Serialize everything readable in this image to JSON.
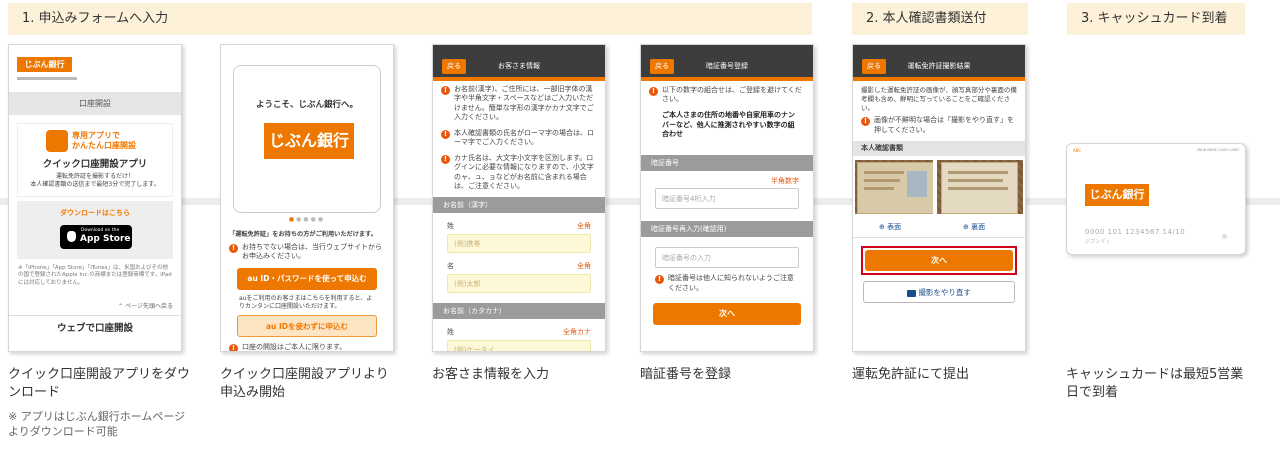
{
  "steps": [
    {
      "label": "1. 申込みフォームへ入力"
    },
    {
      "label": "2. 本人確認書類送付"
    },
    {
      "label": "3. キャッシュカード到着"
    }
  ],
  "brand": {
    "logo": "じぶん銀行",
    "accent": "#ee7700",
    "header_bg": "#fdf2d9",
    "warn": "#e8580c"
  },
  "screen1": {
    "topbar_label": "口座開設",
    "app_line1": "専用アプリで",
    "app_line2": "かんたん口座開設",
    "app_title": "クイック口座開設アプリ",
    "desc": "運転免許証を撮影するだけ！\n本人確認書類の送信まで最短3分で完了します。",
    "download_label": "ダウンロードはこちら",
    "appstore_small": "Download on the",
    "appstore_big": "App Store",
    "footnote": "※「iPhone」「App Store」「iTunes」は、米国およびその他の国で登録されたApple Inc.の商標または登録商標です。iPadには対応しておりません。",
    "page_top": "ページ先頭へ戻る",
    "web_button": "ウェブで口座開設"
  },
  "screen2": {
    "welcome": "ようこそ、じぶん銀行へ。",
    "question": "「運転免許証」をお持ちの方がご利用いただけます。",
    "note1": "お持ちでない場合は、当行ウェブサイトからお申込みください。",
    "btn1": "au ID・パスワードを使って申込む",
    "note2": "auをご利用のお客さまはこちらを利用すると、よりカンタンに口座開設いただけます。",
    "btn2": "au IDを使わずに申込む",
    "note3": "口座の開設はご本人に限ります。"
  },
  "screen3": {
    "back": "戻る",
    "title": "お客さま情報",
    "w1": "お名前(漢字)、ご住所には、一部旧字体の漢字や半角文字・スペースなどはご入力いただけません。簡単な字形の漢字かカナ文字でご入力ください。",
    "w2": "本人確認書類の氏名がローマ字の場合は、ローマ字でご入力ください。",
    "w3": "カナ氏名は、大文字小文字を区別します。ログインに必要な情報になりますので、小文字のャ、ュ、ョなどがお名前に含まれる場合は、ご注意ください。",
    "sec1": "お名前（漢字）",
    "sei": "姓",
    "mei": "名",
    "req1": "全角",
    "ph_sei": "(例)携帯",
    "ph_mei": "(例)太郎",
    "sec2": "お名前（カタカナ）",
    "req2": "全角カナ",
    "ph_kana": "(例)ケータイ"
  },
  "screen4": {
    "back": "戻る",
    "title": "暗証番号登録",
    "w1": "以下の数字の組合せは、ご登録を避けてください。",
    "bold": "ご本人さまの住所の地番や自家用車のナンバーなど、他人に推測されやすい数字の組合わせ",
    "sec1": "暗証番号",
    "req": "半角数字",
    "ph1": "暗証番号4桁入力",
    "sec2": "暗証番号再入力(確認用)",
    "ph2": "暗証番号の入力",
    "w2": "暗証番号は他人に知られないようご注意ください。",
    "next": "次へ"
  },
  "screen5": {
    "back": "戻る",
    "title": "運転免許証撮影結果",
    "desc": "撮影した運転免許証の画像が、顔写真部分や裏面の備考欄も含め、鮮明に写っていることをご確認ください。",
    "warn": "画像が不鮮明な場合は「撮影をやり直す」を押してください。",
    "sec": "本人確認書類",
    "front": "表面",
    "back_side": "裏面",
    "next": "次へ",
    "retake": "撮影をやり直す"
  },
  "card6": {
    "corner_left": "ABC",
    "corner_right": "JIBUN BANK CASH CARD",
    "logo": "じぶん銀行",
    "number": "0000 101 1234567 14/10",
    "name": "ジブン ｷﾞﾝ"
  },
  "captions": [
    "クイック口座開設アプリをダウンロード",
    "クイック口座開設アプリより申込み開始",
    "お客さま情報を入力",
    "暗証番号を登録",
    "運転免許証にて提出",
    "キャッシュカードは最短5営業日で到着"
  ],
  "note": "※ アプリはじぶん銀行ホームページよりダウンロード可能"
}
